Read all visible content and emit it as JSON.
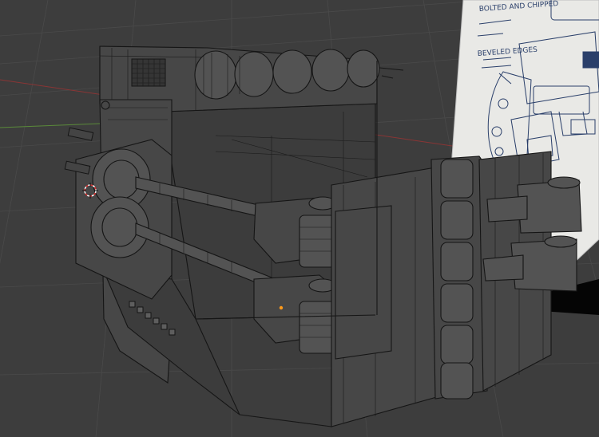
{
  "viewport": {
    "background": "#3d3d3d",
    "grid_color": "#4a4a4a",
    "x_axis_color": "#9a3a3a",
    "y_axis_color": "#5a8a3a",
    "model_wire_color": "#161616",
    "active_vertex_color": "#ff9a1a",
    "cursor_icon": "3d-cursor-icon"
  },
  "reference_image": {
    "annotations": [
      "BOLTED AND CHIPPED",
      "BEVELED EDGES"
    ],
    "ink_color": "#2a3f6a"
  }
}
